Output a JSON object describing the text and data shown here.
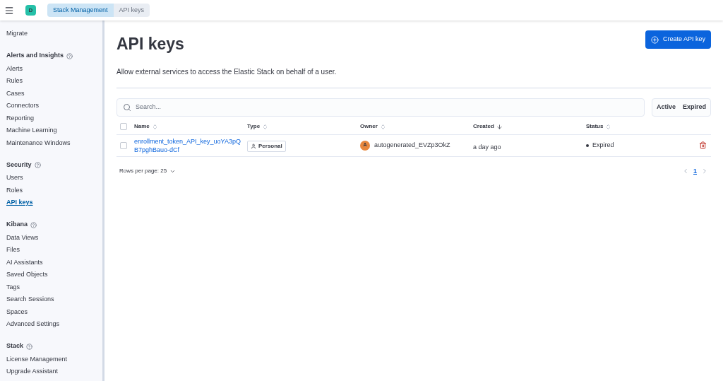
{
  "header": {
    "avatar": "D",
    "breadcrumbs": [
      {
        "label": "Stack Management",
        "selected": false
      },
      {
        "label": "API keys",
        "selected": true
      }
    ]
  },
  "sidebar": {
    "groups": [
      {
        "items": [
          {
            "label": "Migrate",
            "selected": false
          }
        ]
      },
      {
        "title": "Alerts and Insights",
        "items": [
          {
            "label": "Alerts",
            "selected": false
          },
          {
            "label": "Rules",
            "selected": false
          },
          {
            "label": "Cases",
            "selected": false
          },
          {
            "label": "Connectors",
            "selected": false
          },
          {
            "label": "Reporting",
            "selected": false
          },
          {
            "label": "Machine Learning",
            "selected": false
          },
          {
            "label": "Maintenance Windows",
            "selected": false
          }
        ]
      },
      {
        "title": "Security",
        "items": [
          {
            "label": "Users",
            "selected": false
          },
          {
            "label": "Roles",
            "selected": false
          },
          {
            "label": "API keys",
            "selected": true
          }
        ]
      },
      {
        "title": "Kibana",
        "items": [
          {
            "label": "Data Views",
            "selected": false
          },
          {
            "label": "Files",
            "selected": false
          },
          {
            "label": "AI Assistants",
            "selected": false
          },
          {
            "label": "Saved Objects",
            "selected": false
          },
          {
            "label": "Tags",
            "selected": false
          },
          {
            "label": "Search Sessions",
            "selected": false
          },
          {
            "label": "Spaces",
            "selected": false
          },
          {
            "label": "Advanced Settings",
            "selected": false
          }
        ]
      },
      {
        "title": "Stack",
        "items": [
          {
            "label": "License Management",
            "selected": false
          },
          {
            "label": "Upgrade Assistant",
            "selected": false
          }
        ]
      }
    ]
  },
  "page": {
    "title": "API keys",
    "description": "Allow external services to access the Elastic Stack on behalf of a user.",
    "create_button": "Create API key"
  },
  "search": {
    "placeholder": "Search..."
  },
  "filters": [
    "Active",
    "Expired"
  ],
  "table": {
    "select_all_checked": false,
    "columns": [
      {
        "label": "Name",
        "kind": "sortable"
      },
      {
        "label": "Type",
        "kind": "sortable"
      },
      {
        "label": "Owner",
        "kind": "sortable"
      },
      {
        "label": "Created",
        "kind": "sorted_desc"
      },
      {
        "label": "Status",
        "kind": "sortable"
      }
    ],
    "rows": [
      {
        "checked": false,
        "name": "enrollment_token_API_key_uoYA3pQB7pghBauo-dCf",
        "type": "Personal",
        "owner_avatar": "A",
        "owner": "autogenerated_EVZp3OkZ",
        "created": "a day ago",
        "status": "Expired",
        "color": "#343741"
      }
    ]
  },
  "pagination": {
    "rows_per_page": "Rows per page: 25",
    "pages": [
      {
        "label": "1",
        "selected": true
      }
    ]
  }
}
